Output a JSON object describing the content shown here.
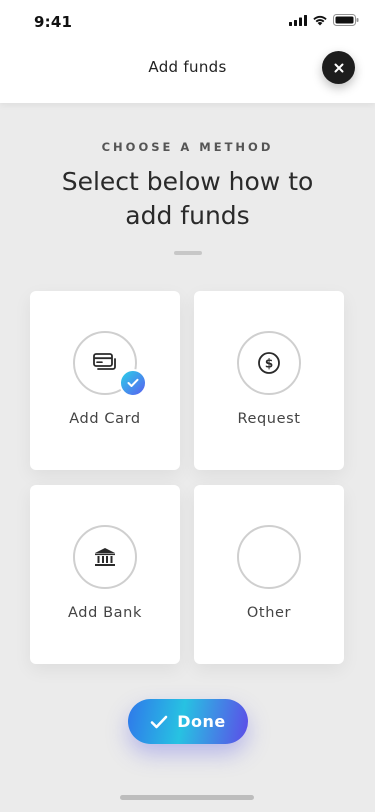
{
  "status_bar": {
    "time": "9:41",
    "icons": [
      "signal-icon",
      "wifi-icon",
      "battery-icon"
    ]
  },
  "header": {
    "title": "Add funds",
    "close_icon": "close-icon"
  },
  "intro": {
    "eyebrow": "CHOOSE A METHOD",
    "headline_line1": "Select below how to",
    "headline_line2": "add funds"
  },
  "methods": [
    {
      "label": "Add Card",
      "icon": "credit-card-icon",
      "selected": true
    },
    {
      "label": "Request",
      "icon": "dollar-coin-icon",
      "selected": false
    },
    {
      "label": "Add Bank",
      "icon": "bank-icon",
      "selected": false
    },
    {
      "label": "Other",
      "icon": "",
      "selected": false
    }
  ],
  "done_button": {
    "label": "Done",
    "icon": "check-icon"
  },
  "colors": {
    "accent_start": "#27c2e2",
    "accent_end": "#5d4be8",
    "background": "#ebebeb",
    "close_button": "#1d1d1d"
  }
}
